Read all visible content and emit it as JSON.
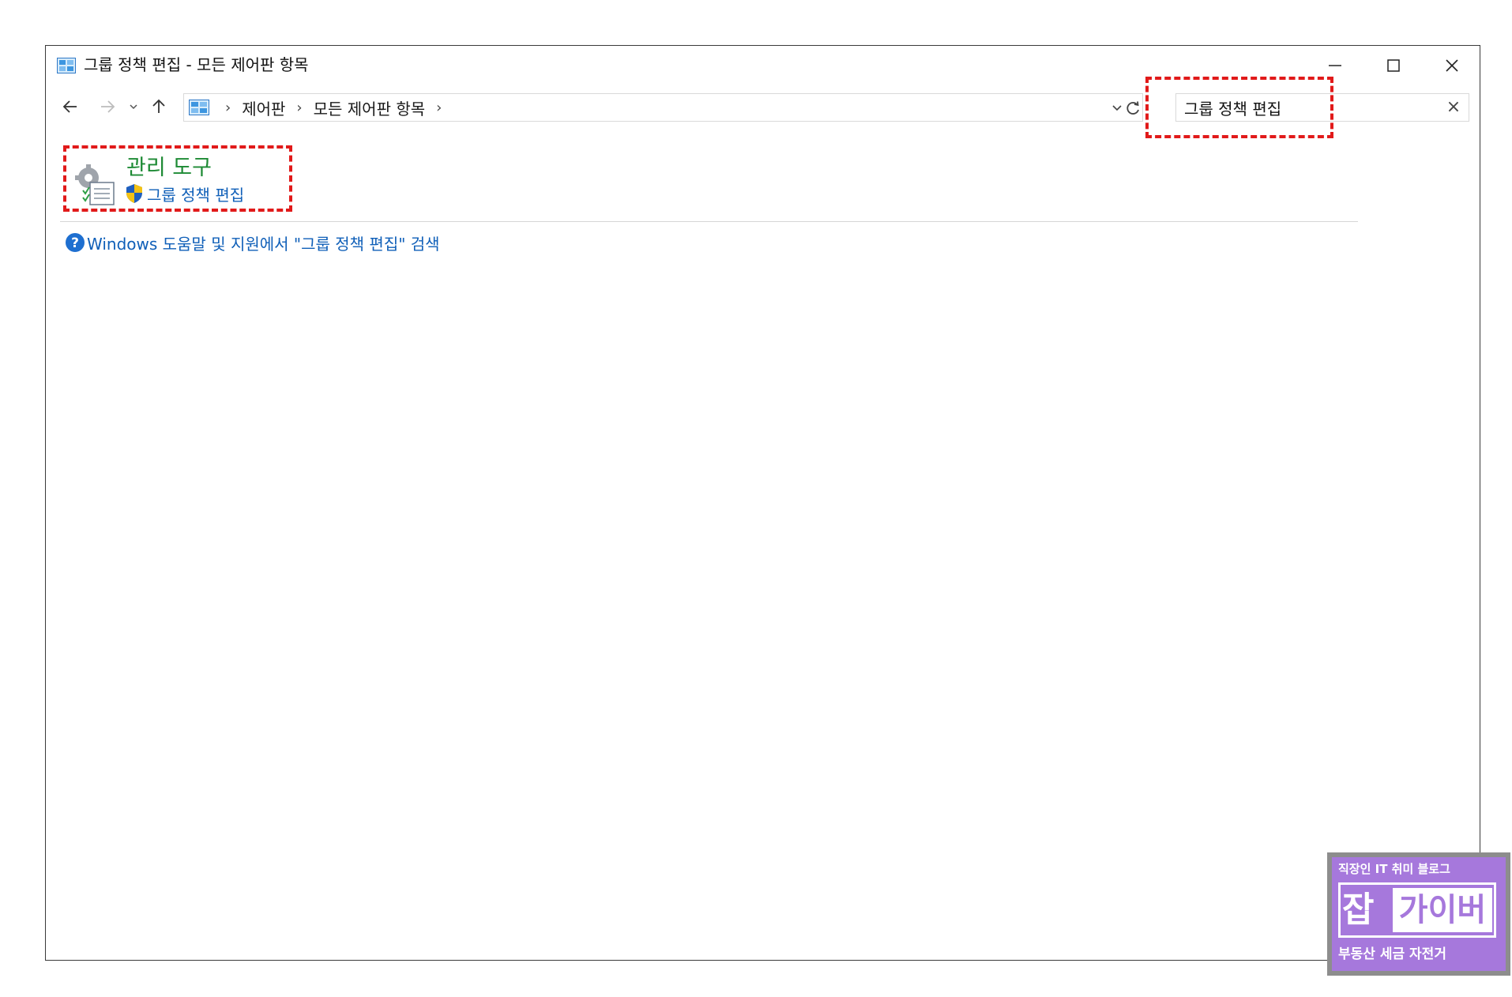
{
  "window": {
    "title": "그룹 정책 편집 - 모든 제어판 항목"
  },
  "address": {
    "breadcrumbs": [
      "제어판",
      "모든 제어판 항목"
    ],
    "separator": "›"
  },
  "search": {
    "value": "그룹 정책 편집",
    "clear_label": "×"
  },
  "results": {
    "category": "관리 도구",
    "task": "그룹 정책 편집"
  },
  "help": {
    "link": "Windows 도움말 및 지원에서 \"그룹 정책 편집\" 검색",
    "icon_glyph": "?"
  },
  "watermark": {
    "top": "직장인 IT 취미 블로그",
    "main_left": "잡",
    "main_right": "가이버",
    "bottom": "부동산 세금 자전거"
  },
  "colors": {
    "category_text": "#1d8a34",
    "link_text": "#0f5fb8",
    "highlight": "#e11a1a",
    "badge": "#a678dc"
  },
  "icons": {
    "title": "control-panel-icon",
    "back": "arrow-left-icon",
    "forward": "arrow-right-icon",
    "recent": "chevron-down-icon",
    "up": "arrow-up-icon",
    "refresh": "refresh-icon",
    "shield": "shield-icon",
    "help": "help-icon"
  }
}
